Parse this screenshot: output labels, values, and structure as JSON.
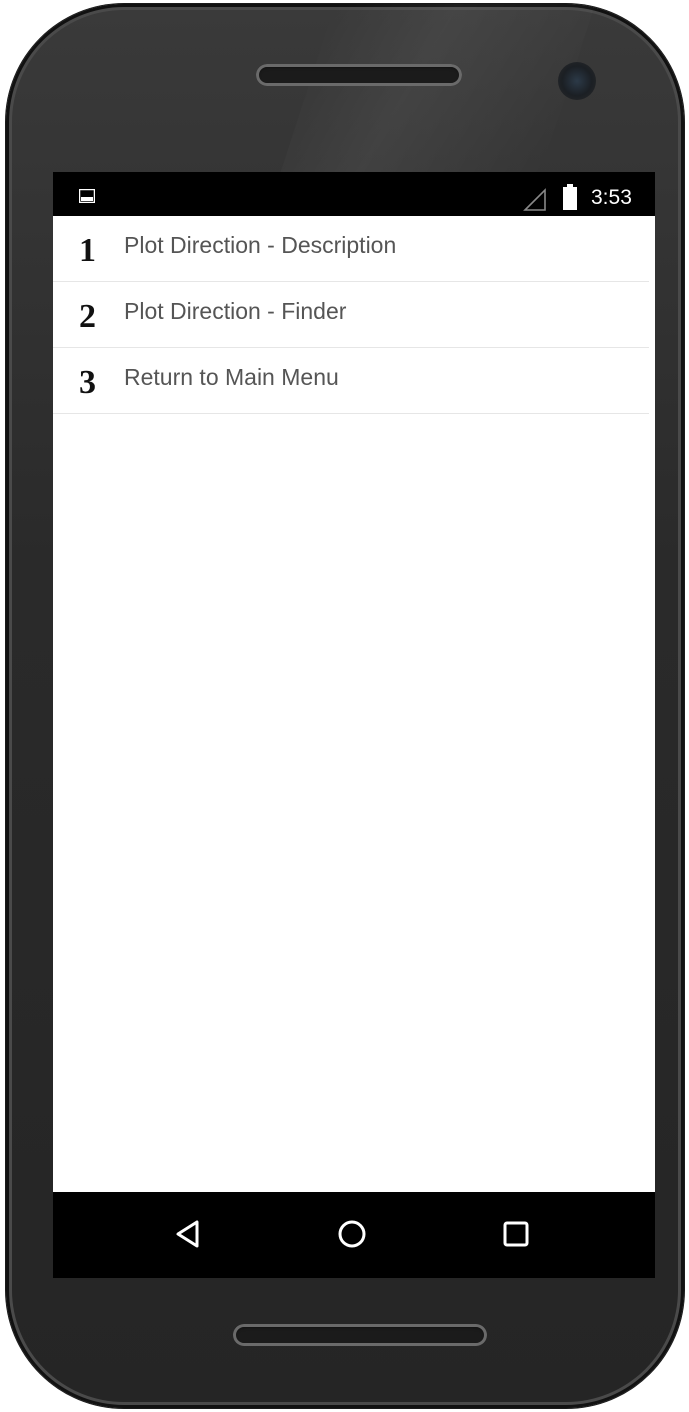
{
  "status_bar": {
    "time": "3:53",
    "left_icon": "image-notification-icon",
    "signal_icon": "signal-icon",
    "battery_icon": "battery-icon"
  },
  "menu": {
    "items": [
      {
        "number": "1",
        "label": "Plot Direction - Description"
      },
      {
        "number": "2",
        "label": "Plot Direction - Finder"
      },
      {
        "number": "3",
        "label": "Return to Main Menu"
      }
    ]
  },
  "nav_bar": {
    "back_icon": "back-triangle-icon",
    "home_icon": "home-circle-icon",
    "recents_icon": "recents-square-icon"
  },
  "colors": {
    "screen_background": "#ffffff",
    "bars": "#000000",
    "label_text": "#555555",
    "number_text": "#111111",
    "divider": "#e6e6e6"
  }
}
